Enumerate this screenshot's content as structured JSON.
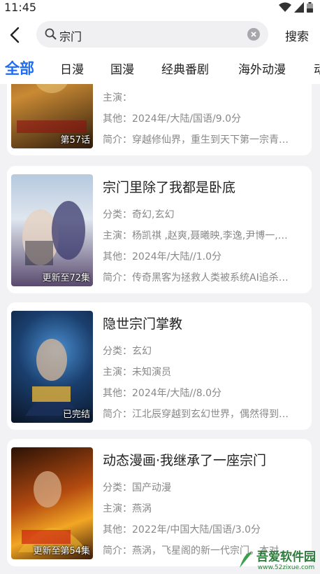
{
  "status": {
    "time": "11:45"
  },
  "search": {
    "query": "宗门",
    "button": "搜索"
  },
  "tabs": [
    {
      "label": "全部",
      "active": true
    },
    {
      "label": "日漫"
    },
    {
      "label": "国漫"
    },
    {
      "label": "经典番剧"
    },
    {
      "label": "海外动漫"
    },
    {
      "label": "动"
    }
  ],
  "cards": [
    {
      "title": "",
      "badge": "第57话",
      "category": "",
      "cast": "主演：",
      "other": "其他：2024年/大陆/国语/9.0分",
      "intro": "简介：穿越修仙界，重生到天下第一宗青…",
      "cover_colors": [
        "#8a5a2a",
        "#d9a441",
        "#3a2212"
      ]
    },
    {
      "title": "宗门里除了我都是卧底",
      "badge": "更新至72集",
      "category": "分类：奇幻,玄幻",
      "cast": "主演：杨凯祺 ,赵爽,聂曦映,李逸,尹博一,…",
      "other": "其他：2024年/大陆//1.0分",
      "intro": "简介：传奇黑客为拯救人类被系统AI追杀…",
      "cover_colors": [
        "#9fb8d4",
        "#c9d6e6",
        "#4a3c5c"
      ]
    },
    {
      "title": "隐世宗门掌教",
      "badge": "已完结",
      "category": "分类：玄幻",
      "cast": "主演：未知演员",
      "other": "其他：2024年/大陆//8.0分",
      "intro": "简介：江北辰穿越到玄幻世界，偶然得到…",
      "cover_colors": [
        "#0e1f3a",
        "#2a6aa8",
        "#e6b33a"
      ]
    },
    {
      "title": "动态漫画·我继承了一座宗门",
      "badge": "更新至第54集",
      "category": "分类：国产动漫",
      "cast": "主演：燕涡",
      "other": "其他：2022年/中国大陆/国语/3.0分",
      "intro": "简介：燕涡，飞星阁的新一代宗门。本对…",
      "cover_colors": [
        "#3a1a0a",
        "#f0a020",
        "#c44010"
      ]
    }
  ],
  "watermark": {
    "title": "吾爱软件园",
    "url": "www.52zixue.com"
  }
}
